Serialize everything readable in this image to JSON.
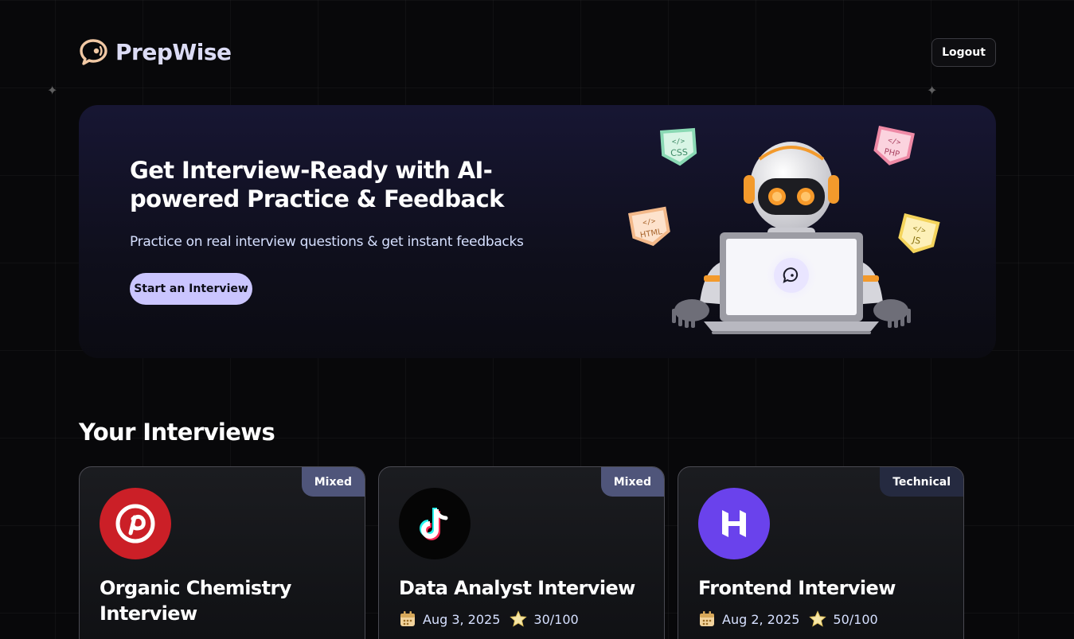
{
  "header": {
    "brand": "PrepWise",
    "logout_label": "Logout"
  },
  "hero": {
    "title": "Get Interview-Ready with AI-powered Practice & Feedback",
    "subtitle": "Practice on real interview questions & get instant feedbacks",
    "cta_label": "Start an Interview",
    "tech_tags": [
      "CSS",
      "PHP",
      "HTML",
      "JS"
    ]
  },
  "interviews": {
    "heading": "Your Interviews",
    "cards": [
      {
        "type": "Mixed",
        "title": "Organic Chemistry Interview",
        "date": "",
        "score": "",
        "logo": "pinterest-logo"
      },
      {
        "type": "Mixed",
        "title": "Data Analyst Interview",
        "date": "Aug 3, 2025",
        "score": "30/100",
        "logo": "tiktok-logo"
      },
      {
        "type": "Technical",
        "title": "Frontend Interview",
        "date": "Aug 2, 2025",
        "score": "50/100",
        "logo": "hostinger-logo"
      }
    ]
  },
  "colors": {
    "accent": "#cac5fe",
    "brand_text": "#dcdcf5",
    "sub_text": "#d6e0ff",
    "badge_mixed": "#4f557a",
    "badge_technical": "#252a40"
  }
}
